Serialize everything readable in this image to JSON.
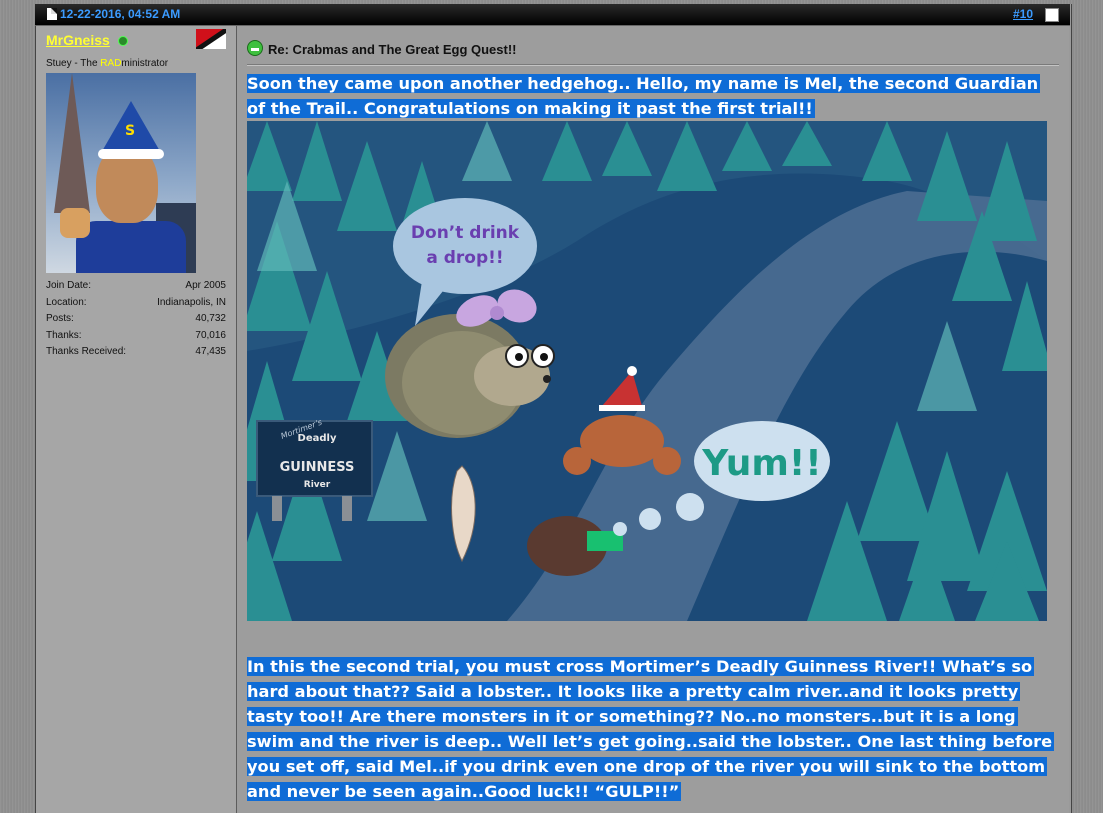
{
  "header": {
    "date": "12-22-2016, 04:52 AM",
    "post_number": "#10"
  },
  "user": {
    "name": "MrGneiss",
    "title_pre": "Stuey - The ",
    "title_rad": "RAD",
    "title_post": "ministrator",
    "stats": [
      {
        "label": "Join Date:",
        "value": "Apr 2005"
      },
      {
        "label": "Location:",
        "value": "Indianapolis, IN"
      },
      {
        "label": "Posts:",
        "value": "40,732"
      },
      {
        "label": "Thanks:",
        "value": "70,016"
      },
      {
        "label": "Thanks Received:",
        "value": "47,435"
      }
    ]
  },
  "post": {
    "title": "Re: Crabmas and The Great Egg Quest!!",
    "paragraph1": "Soon they came upon another hedgehog.. Hello, my name is Mel, the second Guardian of the Trail.. Congratulations on making it past the first trial!!",
    "paragraph2": "In this the second trial, you must cross Mortimer’s Deadly Guinness River!! What’s so hard about that?? Said a lobster.. It looks like a pretty calm river..and it looks pretty tasty too!! Are there monsters in it or something?? No..no monsters..but it is a long swim and the river is deep.. Well let’s get going..said the lobster.. One last thing before you set off, said Mel..if you drink even one drop of the river you will sink to the bottom and never be seen again..Good luck!! “GULP!!”"
  },
  "scene": {
    "bubble1_line1": "Don’t drink",
    "bubble1_line2": "a drop!!",
    "bubble2": "Yum!!",
    "sign_script": "Mortimer’s",
    "sign_line1": "Deadly",
    "sign_line2": "GUINNESS",
    "sign_line3": "River"
  },
  "colors": {
    "link_blue": "#3b9bff",
    "username_yellow": "#ffff33",
    "highlight": "#0f6cd6"
  }
}
